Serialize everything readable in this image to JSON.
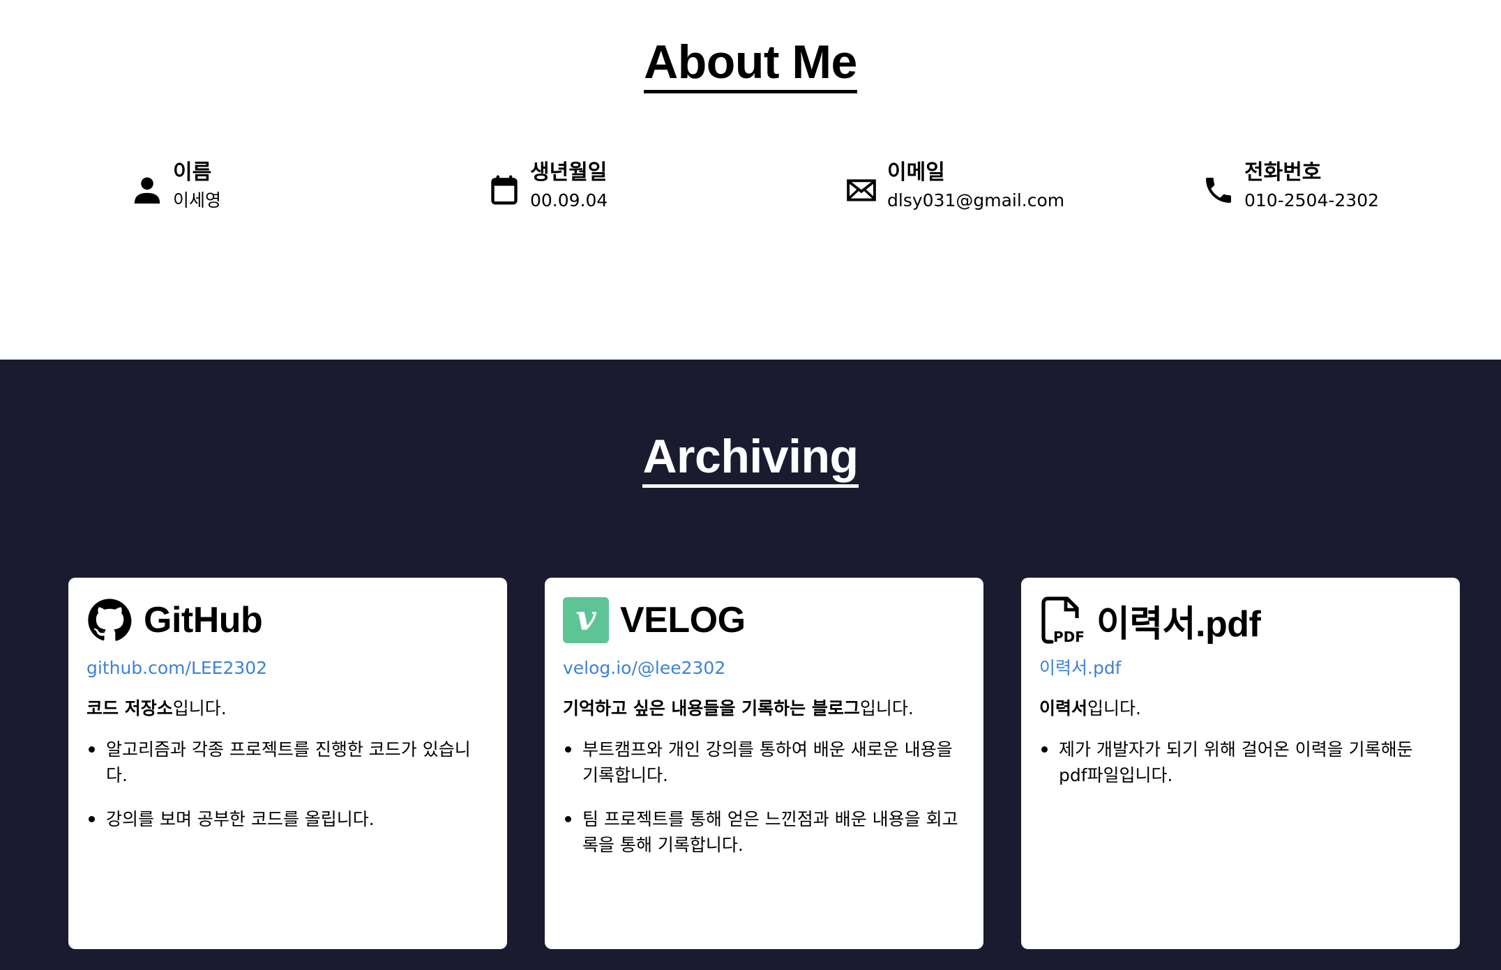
{
  "about": {
    "title": "About Me",
    "items": [
      {
        "icon": "person-icon",
        "label": "이름",
        "value": "이세영"
      },
      {
        "icon": "calendar-icon",
        "label": "생년월일",
        "value": "00.09.04"
      },
      {
        "icon": "mail-icon",
        "label": "이메일",
        "value": "dlsy031@gmail.com"
      },
      {
        "icon": "phone-icon",
        "label": "전화번호",
        "value": "010-2504-2302"
      }
    ]
  },
  "archiving": {
    "title": "Archiving",
    "cards": [
      {
        "icon": "github-icon",
        "title": "GitHub",
        "link": "github.com/LEE2302",
        "desc_bold": "코드 저장소",
        "desc_rest": "입니다.",
        "bullets": [
          "알고리즘과 각종 프로젝트를 진행한 코드가 있습니다.",
          "강의를 보며 공부한 코드를 올립니다."
        ]
      },
      {
        "icon": "velog-icon",
        "icon_letter": "v",
        "icon_color": "#5ec496",
        "title": "VELOG",
        "link": "velog.io/@lee2302",
        "desc_bold": "기억하고 싶은 내용들을 기록하는 블로그",
        "desc_rest": "입니다.",
        "bullets": [
          "부트캠프와 개인 강의를 통하여 배운 새로운 내용을 기록합니다.",
          "팀 프로젝트를 통해 얻은 느낀점과 배운 내용을 회고록을 통해 기록합니다."
        ]
      },
      {
        "icon": "pdf-file-icon",
        "icon_label": "PDF",
        "title": "이력서.pdf",
        "link": "이력서.pdf",
        "desc_bold": "이력서",
        "desc_rest": "입니다.",
        "bullets": [
          "제가 개발자가 되기 위해 걸어온 이력을 기록해둔 pdf파일입니다."
        ]
      }
    ]
  },
  "colors": {
    "dark_bg": "#1a1b2f",
    "link": "#3b82d6",
    "velog_green": "#5ec496"
  }
}
